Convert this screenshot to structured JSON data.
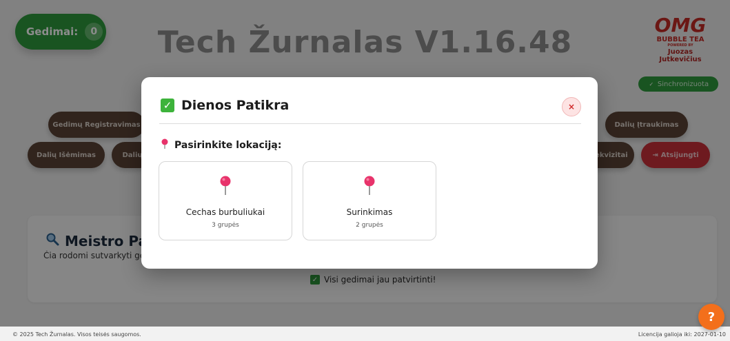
{
  "background": {
    "counter": {
      "label": "Gedimai:",
      "value": "0"
    },
    "app_title": "Tech Žurnalas V1.16.48",
    "brand": {
      "logo": "OMG",
      "line1": "BUBBLE TEA",
      "line2": "POWERED BY",
      "line3": "Juozas",
      "line4": "Jutkevičius"
    },
    "sync_label": "Sinchronizuota",
    "nav": {
      "row1": [
        "Gedimų Registravimas",
        "Dalių Įtraukimas"
      ],
      "row2": [
        "Dalių Išėmimas",
        "Dalių",
        "Rekvizitai",
        "Atsijungti"
      ]
    },
    "panel": {
      "title": "Meistro Patvirtinimai",
      "subtitle": "Čia rodomi sutvarkyti gedimai",
      "all_ok": "Visi gedimai jau patvirtinti!"
    },
    "footer": {
      "copyright": "© 2025 Tech Žurnalas. Visos teisės saugomos.",
      "license": "Licencija galioja iki: 2027-01-10"
    },
    "help": "?"
  },
  "modal": {
    "title": "Dienos Patikra",
    "close": "×",
    "prompt": "Pasirinkite lokaciją:",
    "locations": [
      {
        "name": "Cechas burbuliukai",
        "groups": "3 grupės"
      },
      {
        "name": "Surinkimas",
        "groups": "2 grupės"
      }
    ]
  },
  "colors": {
    "pin": "#e8336b",
    "check": "#3db33b",
    "close_bg": "#fde3e3",
    "close_fg": "#d02a2a"
  }
}
